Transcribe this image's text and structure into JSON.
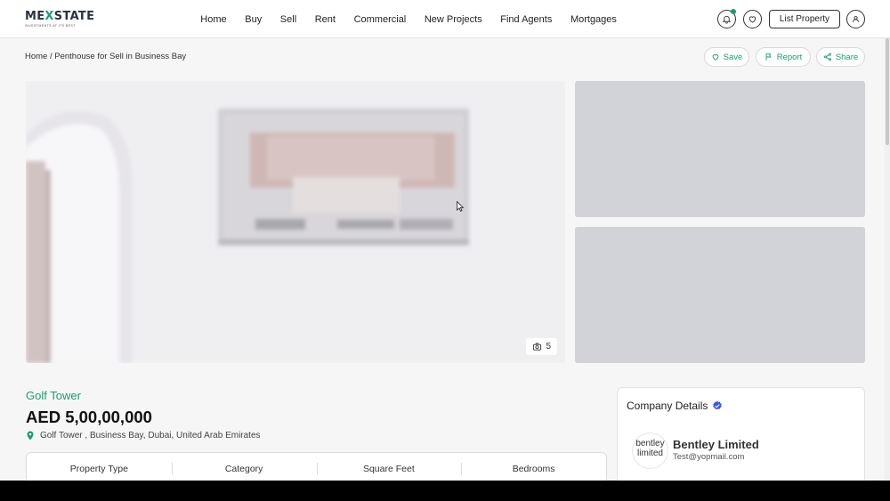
{
  "brand": {
    "name_left": "ME",
    "name_x": "X",
    "name_right": "STATE",
    "tagline": "INVESTMENTS AT ITS BEST"
  },
  "nav": [
    {
      "label": "Home"
    },
    {
      "label": "Buy"
    },
    {
      "label": "Sell"
    },
    {
      "label": "Rent"
    },
    {
      "label": "Commercial"
    },
    {
      "label": "New Projects"
    },
    {
      "label": "Find Agents"
    },
    {
      "label": "Mortgages"
    }
  ],
  "header": {
    "list_property_label": "List Property",
    "icons": [
      "bell-icon",
      "heart-icon",
      "user-icon"
    ]
  },
  "breadcrumb": {
    "text": "Home / Penthouse for Sell in Business Bay"
  },
  "actions": {
    "save_label": "Save",
    "report_label": "Report",
    "share_label": "Share"
  },
  "gallery": {
    "photo_count": "5"
  },
  "property": {
    "title": "Golf Tower",
    "price": "AED 5,00,00,000",
    "location": "Golf Tower , Business Bay, Dubai, United Arab Emirates",
    "spec_headers": [
      "Property Type",
      "Category",
      "Square Feet",
      "Bedrooms"
    ]
  },
  "company": {
    "section_title": "Company Details",
    "logo_text_1": "bentley",
    "logo_text_2": "limited",
    "name": "Bentley Limited",
    "email": "Test@yopmail.com"
  },
  "colors": {
    "accent": "#1f9a72",
    "verified": "#3b5bdb",
    "placeholder": "#d2d3d8"
  }
}
